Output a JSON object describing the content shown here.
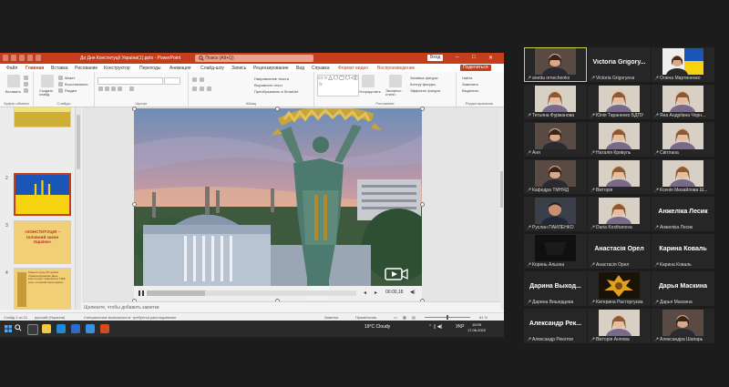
{
  "powerpoint": {
    "titlebar": {
      "doc_title": "До Дня Конституції України(1).pptx  -  PowerPoint",
      "search_placeholder": "Поиск (Alt+Q)",
      "user": "Вход"
    },
    "tabs": [
      {
        "label": "Файл"
      },
      {
        "label": "Главная",
        "active": true
      },
      {
        "label": "Вставка"
      },
      {
        "label": "Рисование"
      },
      {
        "label": "Конструктор"
      },
      {
        "label": "Переходы"
      },
      {
        "label": "Анимация"
      },
      {
        "label": "Слайд-шоу"
      },
      {
        "label": "Запись"
      },
      {
        "label": "Рецензирование"
      },
      {
        "label": "Вид"
      },
      {
        "label": "Справка"
      },
      {
        "label": "Формат видео",
        "highlight": true
      },
      {
        "label": "Воспроизведение",
        "highlight": true
      }
    ],
    "share_label": "Поделиться",
    "ribbon": {
      "paste": "Вставить",
      "create_slide": "Создать слайд",
      "layout": "Макет",
      "reset": "Восстановить",
      "section": "Раздел",
      "group_clipboard": "Буфер обмена",
      "group_slides": "Слайды",
      "group_font": "Шрифт",
      "group_paragraph": "Абзац",
      "group_drawing": "Рисование",
      "group_editing": "Редактирование",
      "text_direction": "Направление текста",
      "align_text": "Выровнять текст",
      "smartart": "Преобразовать в SmartArt",
      "arrange": "Упорядочить",
      "quick_styles": "Экспресс-стили",
      "shape_fill": "Заливка фигуры",
      "shape_outline": "Контур фигуры",
      "shape_effects": "Эффекты фигуры",
      "find": "Найти",
      "replace": "Заменить",
      "select": "Выделить"
    },
    "slide_numbers": [
      "2",
      "3",
      "4",
      "5"
    ],
    "slide3_text": "«КОНСТИТУЦІЯ – головний закон України»",
    "slide4_text": "Кожного року 28 червня Україна відзначає День Конституції. Ухвалена в 1996 році, головний закон країни",
    "video": {
      "time": "00:00,18"
    },
    "notes_placeholder": "Щелкните, чтобы добавить заметки",
    "status": {
      "slide_info": "Слайд 1 из 21",
      "language": "русский (Украина)",
      "accessibility": "Специальные возможности: требуется расследование",
      "notes_btn": "Заметки",
      "comments_btn": "Примечания",
      "zoom": "81 %"
    }
  },
  "taskbar": {
    "weather": "19°C  Cloudy",
    "lang": "УКР",
    "time": "15:09",
    "date": "17.06.2022"
  },
  "gallery": [
    {
      "name": "anetta ornechenko",
      "video": "woman_dark",
      "active": true
    },
    {
      "name": "Victoria Grigoryeva",
      "big": "Victoria  Grigory..."
    },
    {
      "name": "Олена Мартиненко",
      "video": "flag"
    },
    {
      "name": "Тетьяна Фурманова",
      "video": "woman_light"
    },
    {
      "name": "Юлія Тараненко БДПУ",
      "video": "woman_light"
    },
    {
      "name": "Яна Андріївна Чорн...",
      "video": "woman_light"
    },
    {
      "name": "Аня",
      "video": "woman_dark"
    },
    {
      "name": "Наталія Кривуль",
      "video": "woman_light"
    },
    {
      "name": "Світлана",
      "video": "woman_light"
    },
    {
      "name": "Кафедра ТМНЯД",
      "video": "woman_dark"
    },
    {
      "name": "Вікторія",
      "video": "woman_light"
    },
    {
      "name": "Ксенія Михайлова Ш...",
      "video": "woman_light"
    },
    {
      "name": "Руслан ПАЙЛЕНКО",
      "video": "man"
    },
    {
      "name": "Daria Kosthanova",
      "video": "woman_light"
    },
    {
      "name": "Анжеліка Лесик",
      "big": "Анжеліка Лесик"
    },
    {
      "name": "Корень Альона",
      "video": "dark"
    },
    {
      "name": "Анастасія Орел",
      "big": "Анастасія Орел"
    },
    {
      "name": "Карина Коваль",
      "big": "Карина Коваль"
    },
    {
      "name": "Дарина Вишедцева",
      "big": "Дарина  Выход..."
    },
    {
      "name": "Катерина Расторгуєва",
      "video": "gold"
    },
    {
      "name": "Дарья Маскина",
      "big": "Дарья Маскина"
    },
    {
      "name": "Александр Рекотов",
      "big": "Александр  Рек..."
    },
    {
      "name": "Вікторія Анпова",
      "video": "woman_light"
    },
    {
      "name": "Александра Шапарь",
      "video": "woman_dark"
    }
  ]
}
